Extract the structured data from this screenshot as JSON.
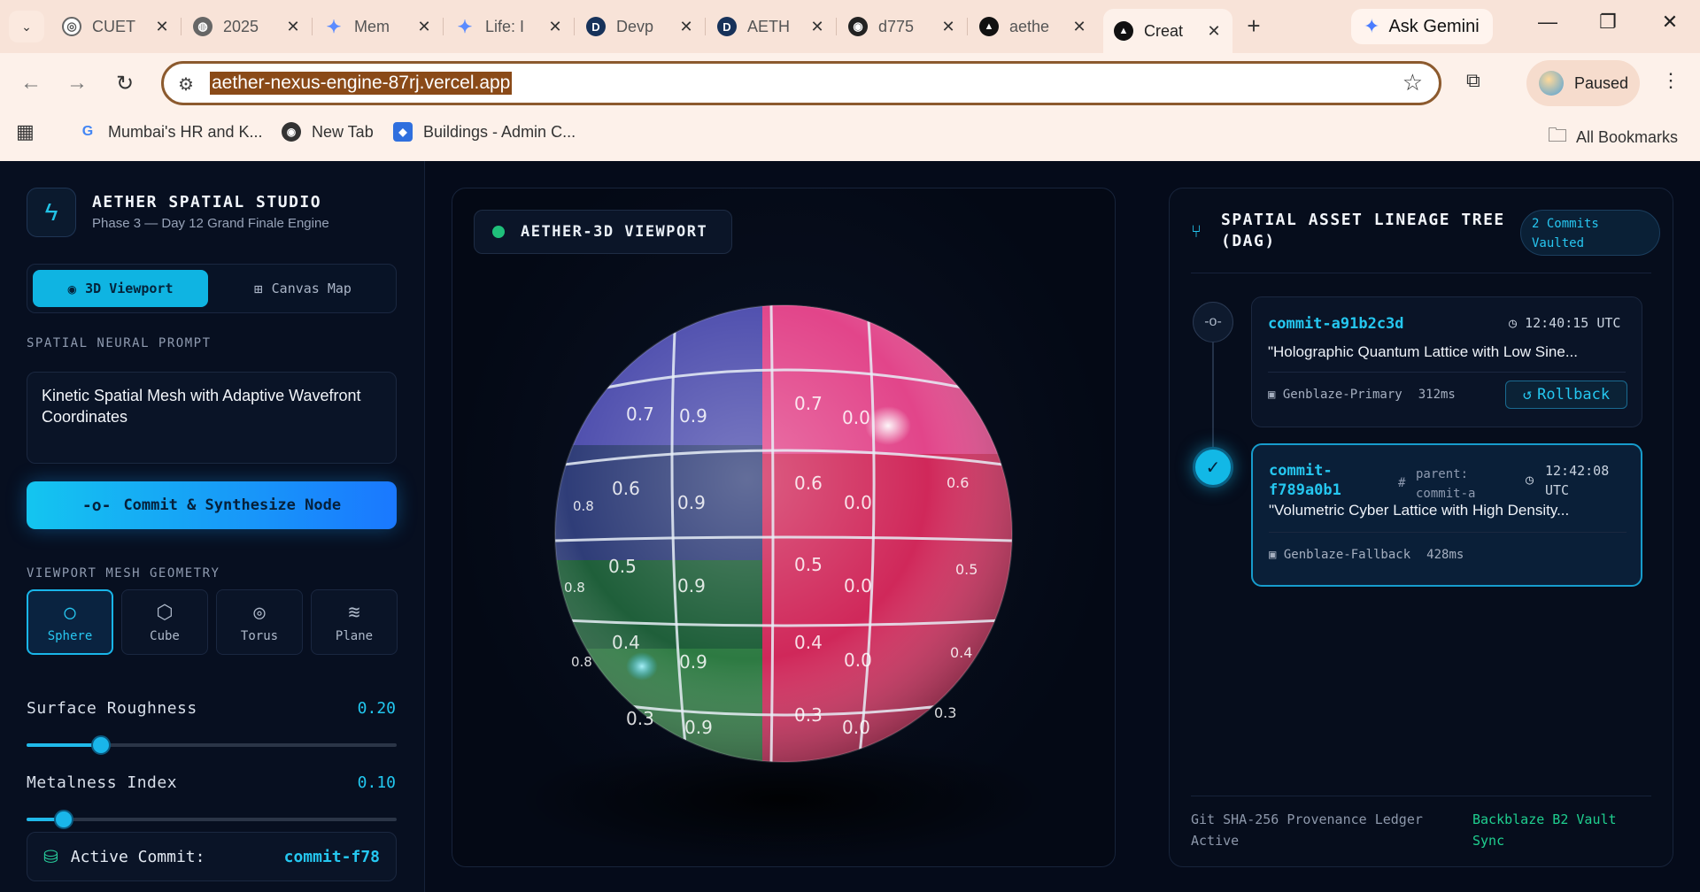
{
  "browser": {
    "tabs": [
      {
        "title": "CUET",
        "icon": "cuet-icon"
      },
      {
        "title": "2025",
        "icon": "globe-icon"
      },
      {
        "title": "Mem",
        "icon": "gemini-icon"
      },
      {
        "title": "Life: I",
        "icon": "gemini-icon"
      },
      {
        "title": "Devp",
        "icon": "d-icon"
      },
      {
        "title": "AETH",
        "icon": "d-icon"
      },
      {
        "title": "d775",
        "icon": "github-icon"
      },
      {
        "title": "aethe",
        "icon": "vercel-icon"
      },
      {
        "title": "Creat",
        "icon": "vercel-icon"
      }
    ],
    "new_tab": "+",
    "ask_gemini": "Ask Gemini",
    "url": "aether-nexus-engine-87rj.vercel.app",
    "profile_status": "Paused",
    "bookmarks": [
      "Mumbai's HR and K...",
      "New Tab",
      "Buildings - Admin C..."
    ],
    "all_bookmarks": "All Bookmarks"
  },
  "sidebar": {
    "app_name": "AETHER SPATIAL STUDIO",
    "app_subtitle": "Phase 3 — Day 12 Grand Finale Engine",
    "modes": [
      "3D Viewport",
      "Canvas Map"
    ],
    "prompt_label": "SPATIAL NEURAL PROMPT",
    "prompt_value": "Kinetic Spatial Mesh with Adaptive Wavefront Coordinates",
    "commit_button": "Commit & Synthesize Node",
    "geometry_label": "VIEWPORT MESH GEOMETRY",
    "geometries": [
      "Sphere",
      "Cube",
      "Torus",
      "Plane"
    ],
    "selected_geometry": "Sphere",
    "roughness": {
      "label": "Surface Roughness",
      "value": "0.20",
      "fraction": 0.2
    },
    "metalness": {
      "label": "Metalness Index",
      "value": "0.10",
      "fraction": 0.1
    },
    "active_commit_label": "Active Commit:",
    "active_commit_value": "commit-f78"
  },
  "viewport": {
    "badge": "AETHER-3D VIEWPORT",
    "status_color": "#1fbf7a",
    "sphere_labels": {
      "left_column": [
        "0.7",
        "0.6",
        "0.5",
        "0.4",
        "0.3"
      ],
      "center_column": [
        "0.9",
        "0.9",
        "0.9",
        "0.9",
        "0.9"
      ],
      "right_inner": [
        "0.7",
        "0.6",
        "0.5",
        "0.4",
        "0.3"
      ],
      "right_column": [
        "0.0",
        "0.0",
        "0.0",
        "0.0",
        "0.0"
      ],
      "edge_right": [
        "0.6",
        "0.5",
        "0.4",
        "0.3"
      ],
      "edge_left": [
        "0.8",
        "0.8",
        "0.8"
      ]
    }
  },
  "lineage": {
    "title": "SPATIAL ASSET LINEAGE TREE (DAG)",
    "commits_pill": "2 Commits Vaulted",
    "commits": [
      {
        "hash": "commit-a91b2c3d",
        "time": "12:40:15 UTC",
        "message": "\"Holographic Quantum Lattice with Low Sine...",
        "engine": "Genblaze-Primary",
        "latency": "312ms",
        "action": "Rollback"
      },
      {
        "hash_line1": "commit-",
        "hash_line2": "f789a0b1",
        "parent_line1": "parent:",
        "parent_line2": "commit-a",
        "time_line1": "12:42:08",
        "time_line2": "UTC",
        "message": "\"Volumetric Cyber Lattice with High Density...",
        "engine": "Genblaze-Fallback",
        "latency": "428ms"
      }
    ],
    "footer_left": "Git SHA-256 Provenance Ledger Active",
    "footer_right": "Backblaze B2 Vault Sync"
  }
}
